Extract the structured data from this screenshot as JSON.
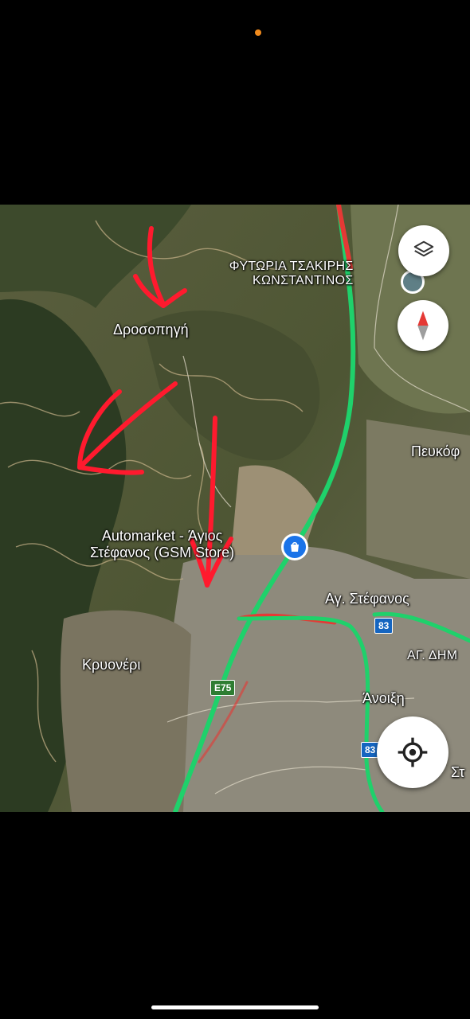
{
  "labels": {
    "nursery_line1": "ΦΥΤΩΡΙΑ ΤΣΑΚΙΡΗΣ",
    "nursery_line2": "ΚΩΝΣΤΑΝΤΙΝΟΣ",
    "drosopigi": "Δροσοπηγή",
    "pefkofyto": "Πευκόφ",
    "automarket_line1": "Automarket - Άγιος",
    "automarket_line2": "Στέφανος (GSM Store)",
    "ag_stefanos": "Αγ. Στέφανος",
    "ag_dim": "ΑΓ. ΔΗΜ",
    "kryoneri": "Κρυονέρι",
    "anoixi": "Άνοιξη",
    "st": "Στ"
  },
  "shields": {
    "route83_top": "83",
    "route83_bottom": "83",
    "e75": "E75"
  },
  "icons": {
    "layers": "layers-icon",
    "compass": "compass-icon",
    "location": "my-location-icon",
    "shopping": "shopping-bag-icon"
  },
  "colors": {
    "traffic_green": "#1fd16b",
    "traffic_red": "#e53935",
    "annotation_red": "#ff1a2e",
    "terrain": "#4a5a35"
  }
}
